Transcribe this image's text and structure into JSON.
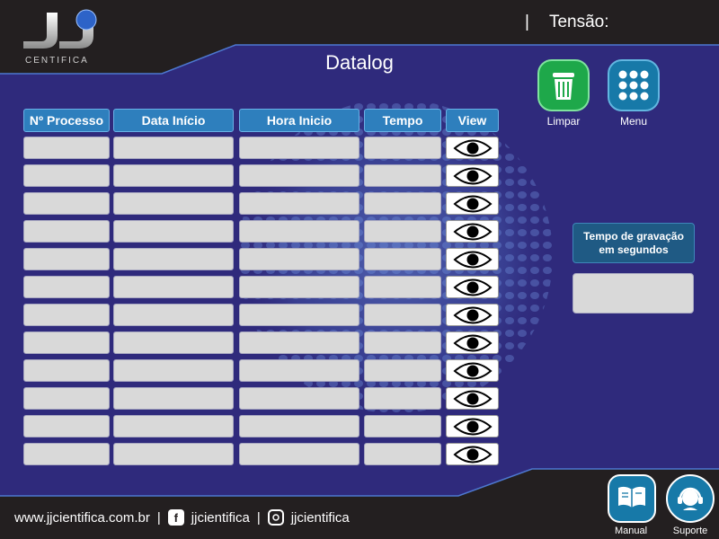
{
  "header": {
    "brand_sub": "CENTIFICA",
    "tension_sep": "|",
    "tension_label": "Tensão:"
  },
  "page": {
    "title": "Datalog"
  },
  "table": {
    "columns": [
      "Nº Processo",
      "Data Início",
      "Hora Inicio",
      "Tempo",
      "View"
    ],
    "row_count": 12
  },
  "actions": {
    "clear_label": "Limpar",
    "menu_label": "Menu"
  },
  "recording": {
    "label": "Tempo de gravação em segundos",
    "value": ""
  },
  "footer": {
    "website": "www.jjcientifica.com.br",
    "sep": "|",
    "facebook": "jjcientifica",
    "instagram": "jjcientifica"
  },
  "support": {
    "manual_label": "Manual",
    "support_label": "Suporte"
  },
  "colors": {
    "panel_blue": "#2f2a7c",
    "header_blue": "#2e7fbd",
    "clear_green": "#1ea84a",
    "menu_teal": "#1779a8"
  },
  "icons": {
    "clear": "trash-icon",
    "menu": "grid-dots-icon",
    "view": "eye-icon",
    "manual": "book-hand-icon",
    "support": "headset-icon",
    "facebook": "facebook-icon",
    "instagram": "instagram-icon"
  }
}
